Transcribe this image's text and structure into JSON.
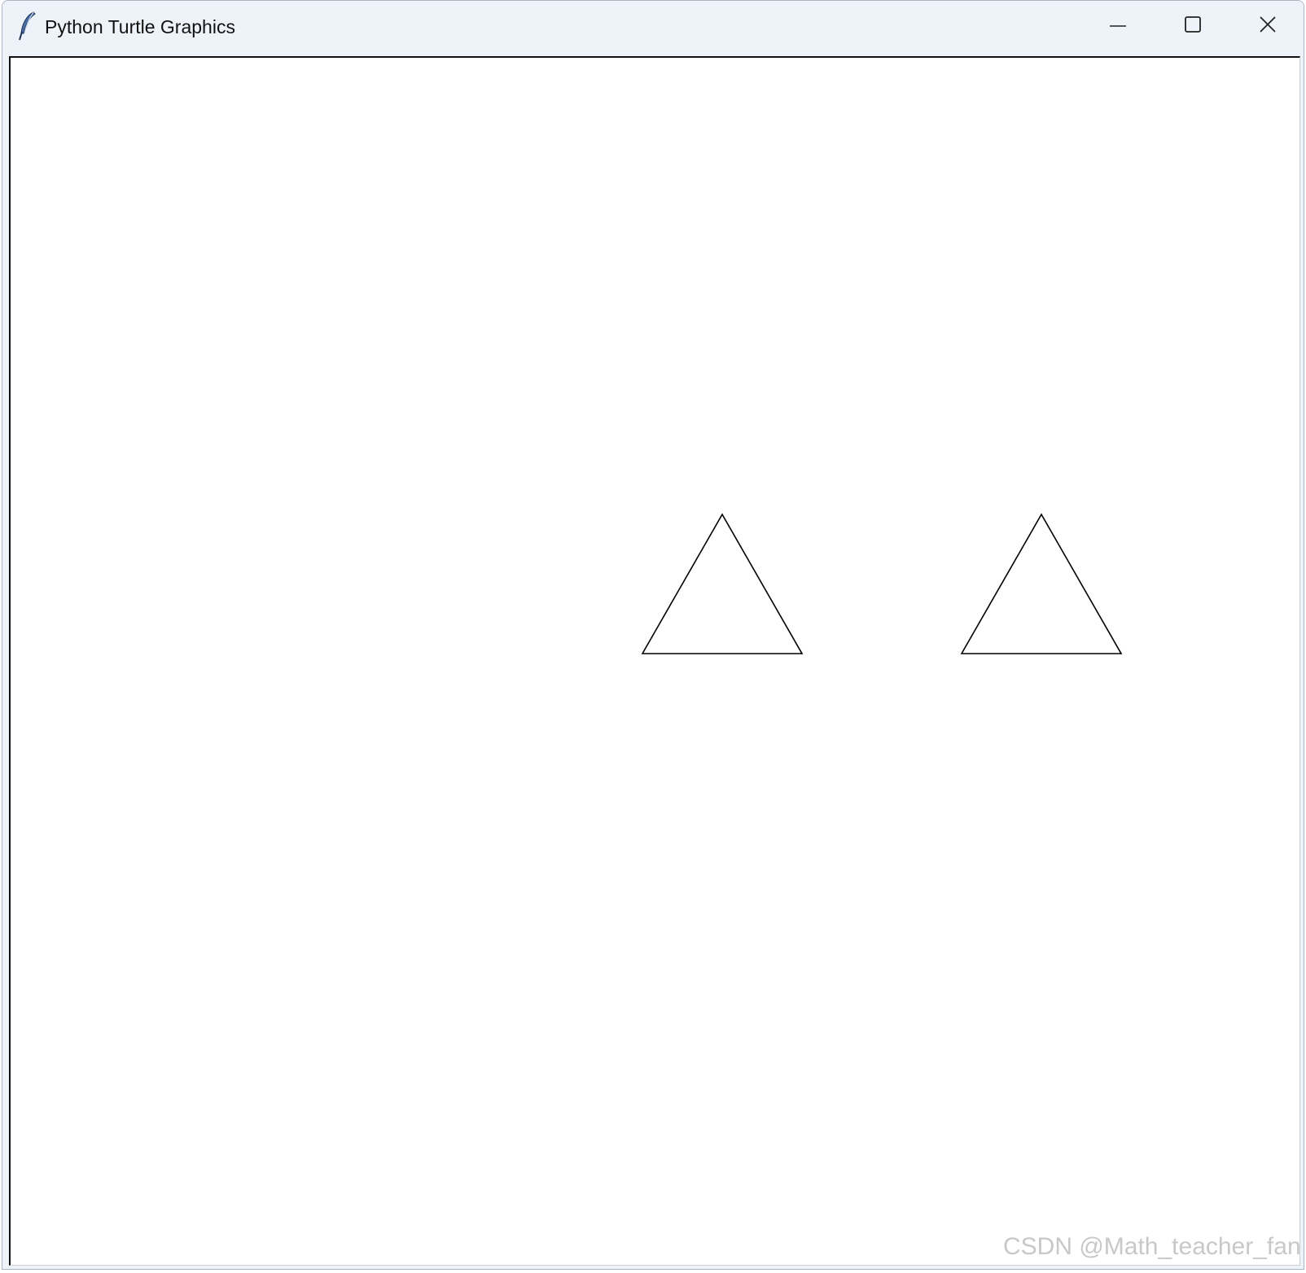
{
  "window": {
    "title": "Python Turtle Graphics",
    "icon": "feather-icon"
  },
  "titlebar_buttons": {
    "minimize": "minimize-icon",
    "maximize": "maximize-icon",
    "close": "close-icon"
  },
  "canvas": {
    "background": "#ffffff",
    "pen_color": "#000000",
    "shapes": [
      {
        "type": "triangle",
        "label": "triangle-left"
      },
      {
        "type": "triangle",
        "label": "triangle-right"
      }
    ]
  },
  "watermark": {
    "text": "CSDN @Math_teacher_fan"
  }
}
